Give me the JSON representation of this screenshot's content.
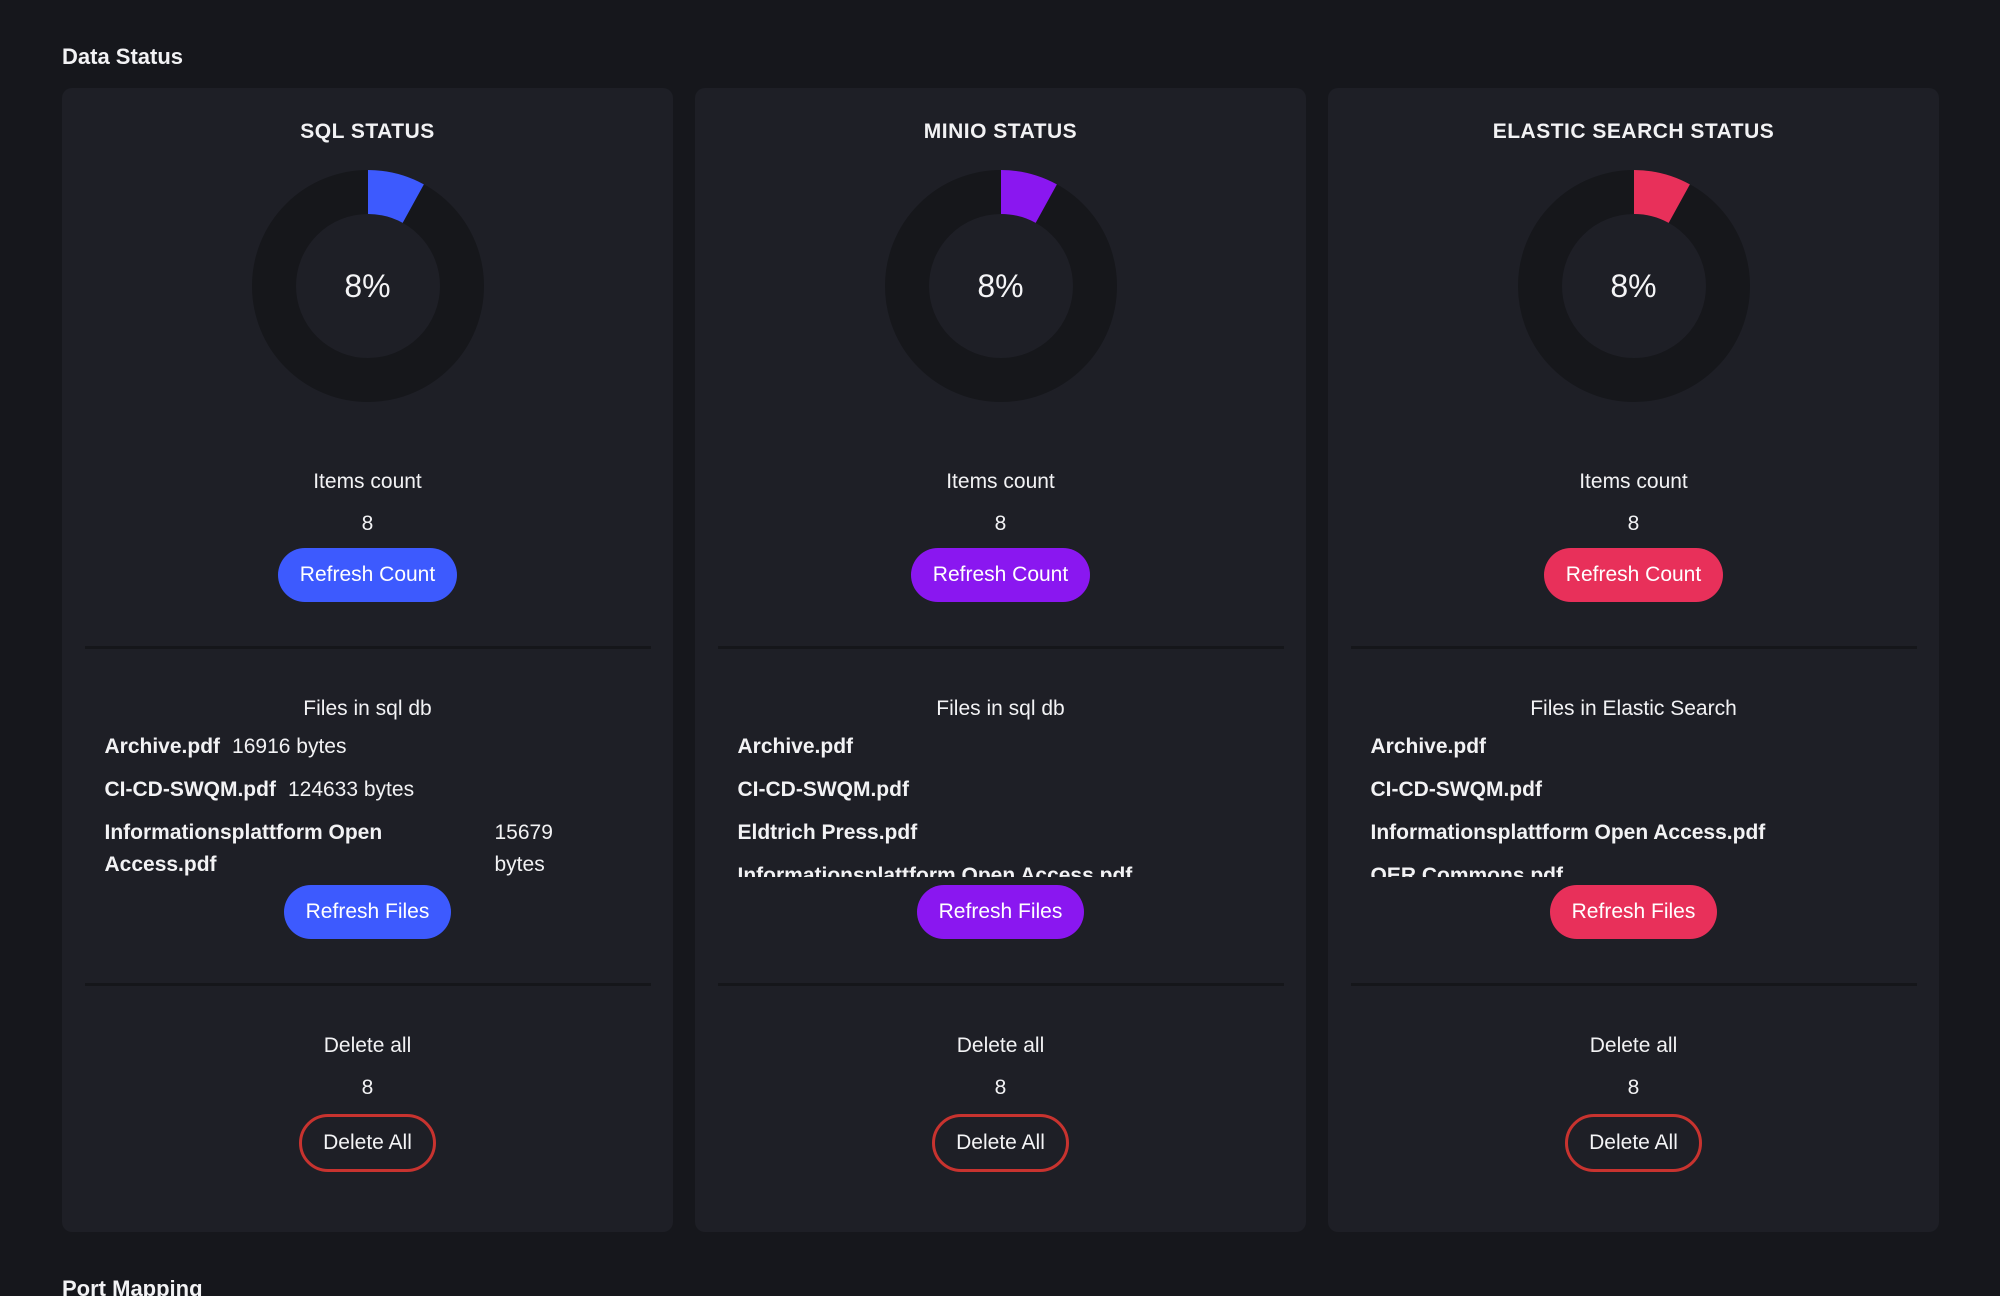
{
  "page": {
    "section_title": "Data Status",
    "next_section_title": "Port Mapping"
  },
  "cards": [
    {
      "title": "SQL STATUS",
      "accent": "#3d5afe",
      "percent": 8,
      "percent_label": "8%",
      "items_label": "Items count",
      "items_value": "8",
      "refresh_count_label": "Refresh Count",
      "files_title": "Files in sql db",
      "files": [
        {
          "name": "Archive.pdf",
          "size": "16916 bytes"
        },
        {
          "name": "CI-CD-SWQM.pdf",
          "size": "124633 bytes"
        },
        {
          "name": "Informationsplattform Open Access.pdf",
          "size": "15679 bytes"
        }
      ],
      "refresh_files_label": "Refresh Files",
      "delete_label": "Delete all",
      "delete_value": "8",
      "delete_button_label": "Delete All"
    },
    {
      "title": "MINIO STATUS",
      "accent": "#8a17f0",
      "percent": 8,
      "percent_label": "8%",
      "items_label": "Items count",
      "items_value": "8",
      "refresh_count_label": "Refresh Count",
      "files_title": "Files in sql db",
      "files": [
        {
          "name": "Archive.pdf",
          "size": ""
        },
        {
          "name": "CI-CD-SWQM.pdf",
          "size": ""
        },
        {
          "name": "Eldtrich Press.pdf",
          "size": ""
        },
        {
          "name": "Informationsplattform Open Access.pdf",
          "size": ""
        }
      ],
      "refresh_files_label": "Refresh Files",
      "delete_label": "Delete all",
      "delete_value": "8",
      "delete_button_label": "Delete All"
    },
    {
      "title": "ELASTIC SEARCH STATUS",
      "accent": "#e8305a",
      "percent": 8,
      "percent_label": "8%",
      "items_label": "Items count",
      "items_value": "8",
      "refresh_count_label": "Refresh Count",
      "files_title": "Files in Elastic Search",
      "files": [
        {
          "name": "Archive.pdf",
          "size": ""
        },
        {
          "name": "CI-CD-SWQM.pdf",
          "size": ""
        },
        {
          "name": "Informationsplattform Open Access.pdf",
          "size": ""
        },
        {
          "name": "OER Commons.pdf",
          "size": ""
        }
      ],
      "refresh_files_label": "Refresh Files",
      "delete_label": "Delete all",
      "delete_value": "8",
      "delete_button_label": "Delete All"
    }
  ]
}
